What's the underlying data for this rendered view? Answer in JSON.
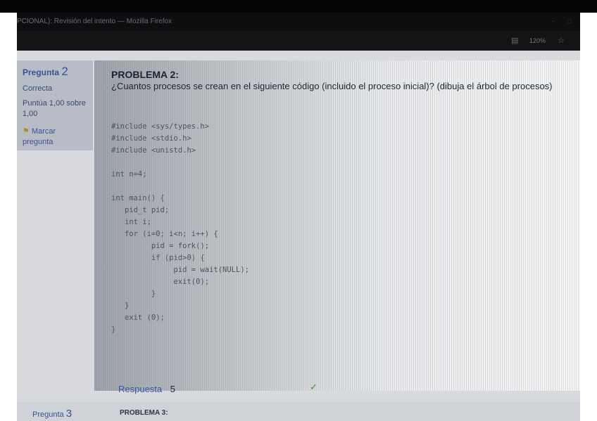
{
  "window": {
    "title": "PCIONAL): Revisión del intento — Mozilla Firefox",
    "controls": [
      "-",
      "□"
    ]
  },
  "browser": {
    "zoom": "120%",
    "icons": [
      "reader-icon",
      "bookmark-star-icon"
    ]
  },
  "question_info": {
    "label": "Pregunta",
    "number": "2",
    "state": "Correcta",
    "grade": "Puntúa 1,00 sobre 1,00",
    "flag_label": "Marcar pregunta"
  },
  "question": {
    "title": "PROBLEMA 2:",
    "text": "¿Cuantos procesos se crean en el siguiente código (incluido el proceso inicial)? (dibuja el árbol de procesos)",
    "code": "#include <sys/types.h>\n#include <stdio.h>\n#include <unistd.h>\n\nint n=4;\n\nint main() {\n   pid_t pid;\n   int i;\n   for (i=0; i<n; i++) {\n         pid = fork();\n         if (pid>0) {\n              pid = wait(NULL);\n              exit(0);\n         }\n   }\n   exit (0);\n}",
    "answer_label": "Respuesta",
    "answer_value": "5"
  },
  "next_question": {
    "label": "Pregunta",
    "number": "3",
    "title": "PROBLEMA 3:"
  },
  "colors": {
    "accent": "#3a5391",
    "info_bg": "#b7bcc6",
    "correct": "#3c8a3c"
  }
}
